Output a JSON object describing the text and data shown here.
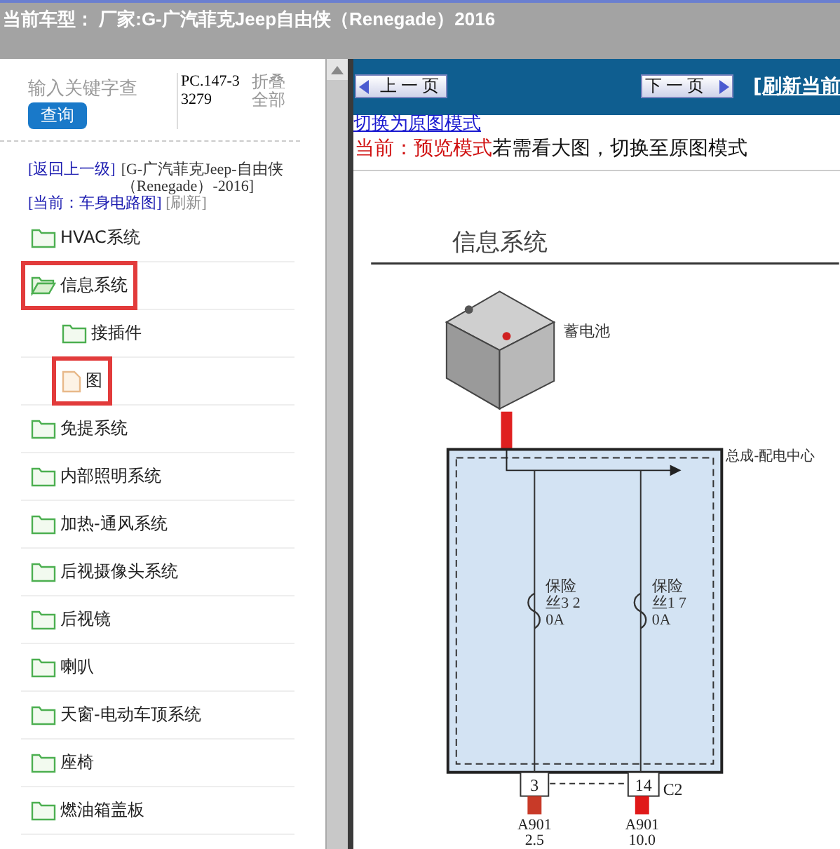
{
  "header": {
    "title": "当前车型： 厂家:G-广汽菲克Jeep自由侠（Renegade）2016"
  },
  "sidebar": {
    "search": {
      "placeholder": "输入关键字查",
      "button": "查询"
    },
    "code": "PC.147-33279",
    "collapse_all": "折叠全部",
    "breadcrumb": {
      "back": "[返回上一级]",
      "path": "[G-广汽菲克Jeep-自由侠（Renegade）-2016]",
      "current": "[当前：车身电路图]",
      "refresh": "[刷新]"
    },
    "tree": [
      {
        "label": "HVAC系统",
        "kind": "folder",
        "expanded": false,
        "highlighted": false
      },
      {
        "label": "信息系统",
        "kind": "folder",
        "expanded": true,
        "highlighted": true,
        "children": [
          {
            "label": "接插件",
            "kind": "folder",
            "expanded": false,
            "highlighted": false
          },
          {
            "label": "图",
            "kind": "file",
            "highlighted": true
          }
        ]
      },
      {
        "label": "免提系统",
        "kind": "folder",
        "expanded": false,
        "highlighted": false
      },
      {
        "label": "内部照明系统",
        "kind": "folder",
        "expanded": false,
        "highlighted": false
      },
      {
        "label": "加热-通风系统",
        "kind": "folder",
        "expanded": false,
        "highlighted": false
      },
      {
        "label": "后视摄像头系统",
        "kind": "folder",
        "expanded": false,
        "highlighted": false
      },
      {
        "label": "后视镜",
        "kind": "folder",
        "expanded": false,
        "highlighted": false
      },
      {
        "label": "喇叭",
        "kind": "folder",
        "expanded": false,
        "highlighted": false
      },
      {
        "label": "天窗-电动车顶系统",
        "kind": "folder",
        "expanded": false,
        "highlighted": false
      },
      {
        "label": "座椅",
        "kind": "folder",
        "expanded": false,
        "highlighted": false
      },
      {
        "label": "燃油箱盖板",
        "kind": "folder",
        "expanded": false,
        "highlighted": false
      }
    ]
  },
  "toolbar": {
    "prev": "上一页",
    "next": "下一页",
    "refresh": "[刷新当前"
  },
  "mode": {
    "link": "切换为原图模式",
    "status": "当前：预览模式",
    "hint": "若需看大图，切换至原图模式"
  },
  "diagram": {
    "title": "信息系统",
    "battery": "蓄电池",
    "module": "总成-配电中心",
    "fuses": [
      {
        "lines": [
          "保险",
          "丝3 2",
          "0A"
        ]
      },
      {
        "lines": [
          "保险",
          "丝1 7",
          "0A"
        ]
      }
    ],
    "pins": [
      "3",
      "14"
    ],
    "connector": "C2",
    "wires": [
      {
        "code": "A901",
        "size": "2.5",
        "color": "#c83a28"
      },
      {
        "code": "A901",
        "size": "10.0",
        "color": "#e01818"
      }
    ]
  }
}
